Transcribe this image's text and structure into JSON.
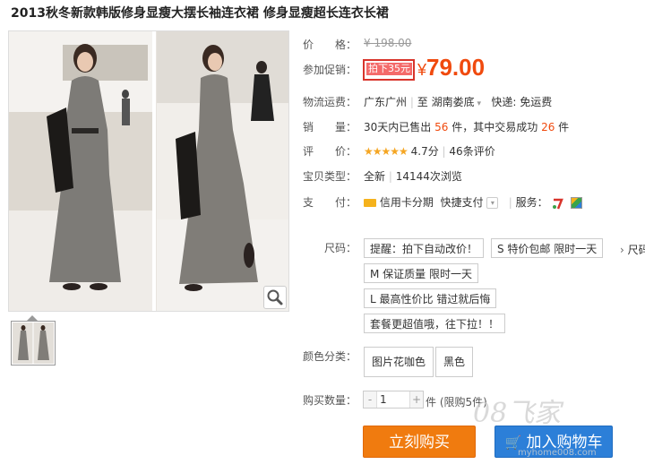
{
  "product": {
    "title": "2013秋冬新款韩版修身显瘦大摆长袖连衣裙 修身显瘦超长连衣长裙"
  },
  "gallery": {
    "zoom_icon": "magnifier-icon",
    "thumbnail_count": 1
  },
  "price": {
    "label": "价　　格：",
    "original": "¥ 198.00"
  },
  "promotion": {
    "label": "参加促销：",
    "badge": "拍下35元",
    "currency": "¥",
    "price": "79.00"
  },
  "shipping": {
    "label": "物流运费：",
    "from": "广东广州",
    "to_prefix": "至",
    "to": "湖南娄底",
    "express": "快递: 免运费"
  },
  "sales": {
    "label": "销　　量：",
    "prefix": "30天内已售出",
    "sold": "56",
    "mid": "件，其中交易成功",
    "success": "26",
    "suffix": "件"
  },
  "rating": {
    "label": "评　　价：",
    "stars": "★★★★★",
    "score": "4.7分",
    "reviews": "46条评价"
  },
  "type": {
    "label": "宝贝类型：",
    "condition": "全新",
    "views": "14144次浏览"
  },
  "payment": {
    "label": "支　　付：",
    "installment": "信用卡分期",
    "quick": "快捷支付",
    "service_label": "服务："
  },
  "size": {
    "label": "尺码：",
    "options": [
      "提醒：拍下自动改价！",
      "S 特价包邮 限时一天",
      "M 保证质量 限时一天",
      "L 最高性价比 错过就后悔",
      "套餐更超值哦，往下拉！！"
    ],
    "overflow": "尺码"
  },
  "color": {
    "label": "颜色分类：",
    "options": [
      "图片花咖色",
      "黑色"
    ]
  },
  "quantity": {
    "label": "购买数量：",
    "value": "1",
    "minus": "-",
    "plus": "+",
    "limit": "件 (限购5件)"
  },
  "actions": {
    "buy_now": "立刻购买",
    "add_cart": "加入购物车"
  },
  "watermark": {
    "text": "08飞家",
    "url": "myhome008.com"
  },
  "colors": {
    "accent_orange": "#f07b0f",
    "price_red": "#f04a0e",
    "cart_blue": "#2c7fd8",
    "promo_border": "#d8342b"
  }
}
